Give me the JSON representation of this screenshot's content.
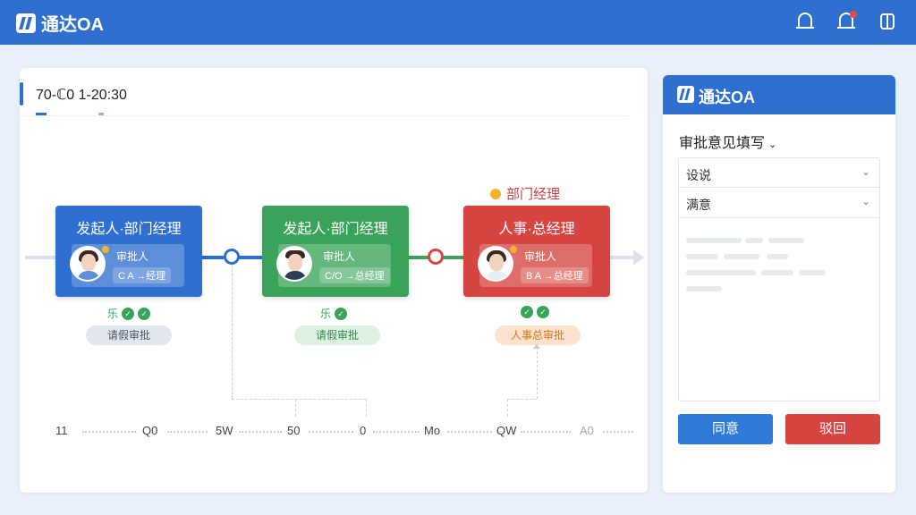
{
  "app": {
    "title": "通达OA",
    "brand_color": "#2f6fd0"
  },
  "header": {
    "icons": [
      "bell-icon",
      "notification-bell-icon",
      "cube-icon"
    ]
  },
  "tab": {
    "label": "70-ℂ0   1-20:30"
  },
  "top_annotation": "部门经理",
  "nodes": [
    {
      "title": "发起人·部门经理",
      "role1": "审批人",
      "role2": "C A →经理",
      "color": "#2f6fd0",
      "badge": "乐",
      "pill": "请假审批",
      "pill_color": "#e3e7ee",
      "pill_text_color": "#4b5668"
    },
    {
      "title": "发起人·部门经理",
      "role1": "审批人",
      "role2": "C/O →总经理",
      "color": "#3aa35a",
      "badge": "乐",
      "pill": "请假审批",
      "pill_color": "#def1e3",
      "pill_text_color": "#2f8a48"
    },
    {
      "title": "人事·总经理",
      "role1": "审批人",
      "role2": "B A →总经理",
      "color": "#d64541",
      "badge": "",
      "pill": "人事总审批",
      "pill_color": "#fde3cf",
      "pill_text_color": "#d3771b"
    }
  ],
  "axis_ticks": [
    "11",
    "Q0",
    "5W",
    "50",
    "0",
    "Mo",
    "QW",
    "A0"
  ],
  "side": {
    "brand": "通达OA",
    "title": "审批意见填写",
    "select1": "设说",
    "select2": "满意",
    "agree": "同意",
    "reject": "驳回"
  }
}
